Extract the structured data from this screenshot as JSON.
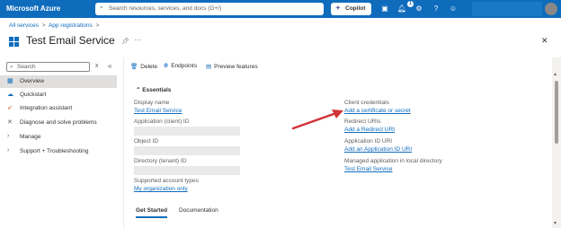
{
  "topbar": {
    "brand": "Microsoft Azure",
    "search_placeholder": "Search resources, services, and docs (G+/)",
    "copilot_label": "Copilot",
    "notification_count": "1"
  },
  "breadcrumb": {
    "items": [
      "All services",
      "App registrations"
    ],
    "separator": ">"
  },
  "page": {
    "title": "Test Email Service"
  },
  "sidebar": {
    "search_placeholder": "Search",
    "clear_glyph": "x",
    "collapse_glyph": "«",
    "items": [
      {
        "label": "Overview",
        "icon": "grid-icon",
        "active": true
      },
      {
        "label": "Quickstart",
        "icon": "cloud-icon"
      },
      {
        "label": "Integration assistant",
        "icon": "rocket-icon"
      },
      {
        "label": "Diagnose and solve problems",
        "icon": "wrench-icon"
      },
      {
        "label": "Manage",
        "icon": "chevron-right-icon"
      },
      {
        "label": "Support + Troubleshooting",
        "icon": "chevron-right-icon"
      }
    ]
  },
  "commands": {
    "delete": "Delete",
    "endpoints": "Endpoints",
    "preview": "Preview features"
  },
  "essentials": {
    "title": "Essentials",
    "left": {
      "display_name_label": "Display name",
      "display_name_value": "Test Email Service",
      "client_id_label": "Application (client) ID",
      "object_id_label": "Object ID",
      "tenant_id_label": "Directory (tenant) ID",
      "account_types_label": "Supported account types",
      "account_types_value": "My organization only"
    },
    "right": {
      "client_cred_label": "Client credentials",
      "client_cred_value": "Add a certificate or secret",
      "redirect_label": "Redirect URIs",
      "redirect_value": "Add a Redirect URI",
      "app_id_uri_label": "Application ID URI",
      "app_id_uri_value": "Add an Application ID URI",
      "managed_label": "Managed application in local directory",
      "managed_value": "Test Email Service"
    }
  },
  "tabs": [
    "Get Started",
    "Documentation"
  ],
  "colors": {
    "brand_blue": "#0f6cbd",
    "annotation_arrow": "#d13438"
  }
}
